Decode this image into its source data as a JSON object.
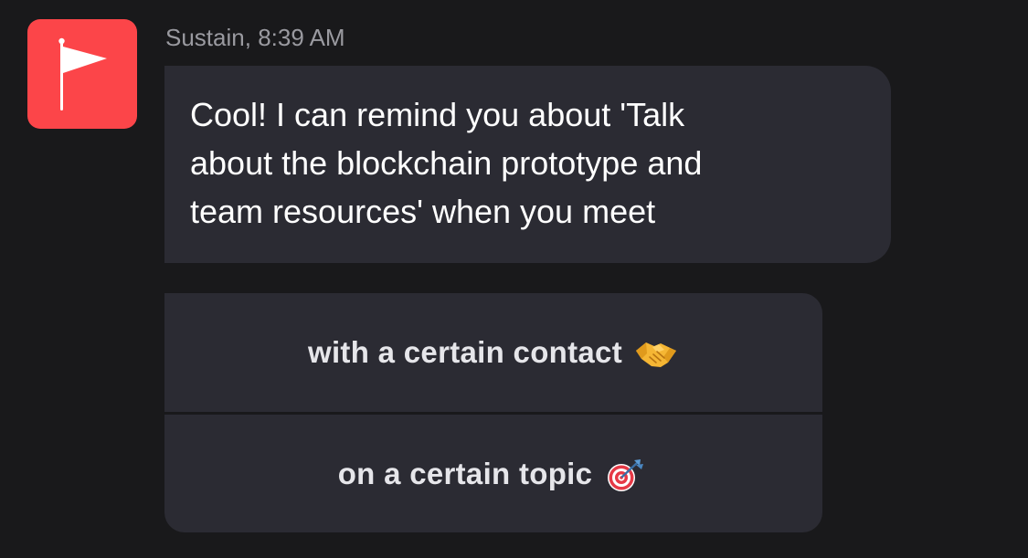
{
  "message": {
    "sender": "Sustain",
    "separator": ", ",
    "time": "8:39 AM",
    "text": "Cool! I can remind you about 'Talk\nabout the blockchain prototype and\nteam resources' when you meet",
    "avatar_icon": "flag-icon",
    "avatar_color": "#fc4549"
  },
  "options": [
    {
      "label": "with a certain contact",
      "icon": "handshake-icon"
    },
    {
      "label": "on a certain topic",
      "icon": "target-icon"
    }
  ],
  "colors": {
    "background": "#19191b",
    "bubble": "#2b2b33",
    "text": "#ffffff",
    "meta_text": "#9a9aa0",
    "option_text": "#e6e6ea"
  }
}
